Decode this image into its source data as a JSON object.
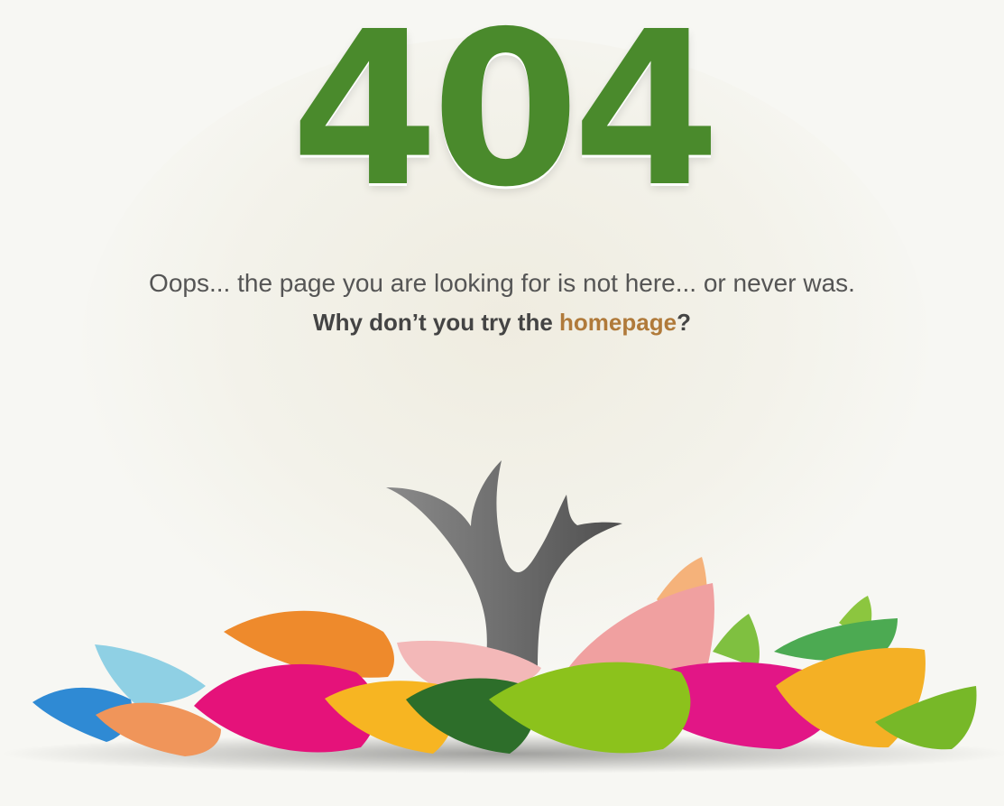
{
  "error": {
    "code": "404",
    "message": "Oops... the page you are looking for is not here... or never was.",
    "suggestion_prefix": "Why don’t you try the ",
    "link_label": "homepage",
    "suggestion_suffix": "?"
  },
  "colors": {
    "code_green": "#4a8a2c",
    "link_brown": "#b07a3a",
    "text_gray": "#555555",
    "background": "#f7f7f3"
  },
  "illustration": {
    "icon": "bare-tree-in-leaf-pile-icon"
  }
}
